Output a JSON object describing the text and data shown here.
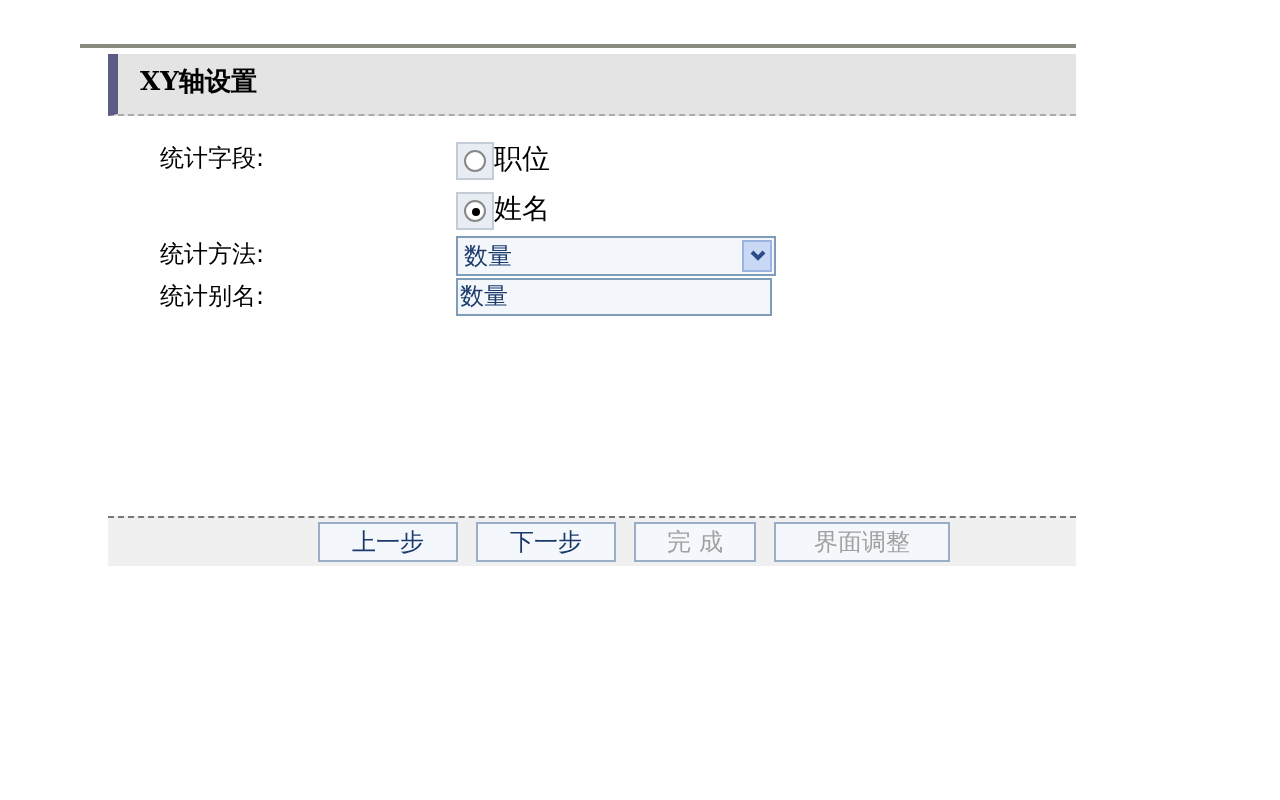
{
  "panel": {
    "title": "XY轴设置"
  },
  "fields": [
    {
      "kind": "radio",
      "label": "统计字段:",
      "options": [
        {
          "label": "职位",
          "selected": false
        },
        {
          "label": "姓名",
          "selected": true
        }
      ]
    },
    {
      "kind": "select",
      "label": "统计方法:",
      "value": "数量"
    },
    {
      "kind": "text",
      "label": "统计别名:",
      "value": "数量"
    }
  ],
  "buttons": [
    {
      "label": "上一步",
      "disabled": false
    },
    {
      "label": "下一步",
      "disabled": false
    },
    {
      "label": "完 成",
      "disabled": true
    },
    {
      "label": "界面调整",
      "disabled": true
    }
  ]
}
